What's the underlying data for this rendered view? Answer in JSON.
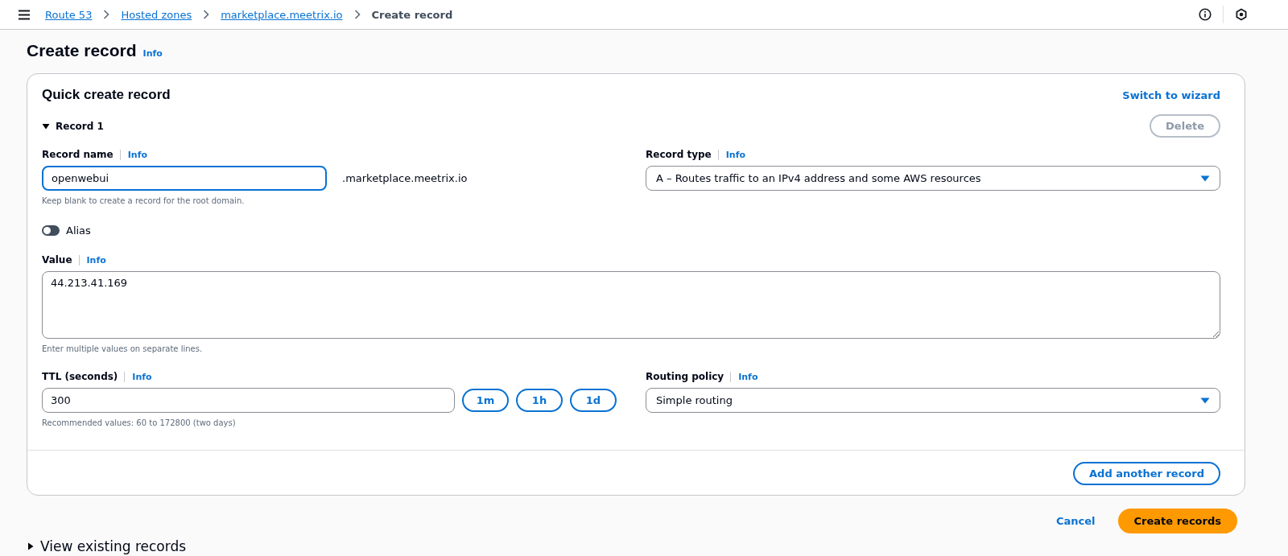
{
  "breadcrumbs": [
    {
      "label": "Route 53",
      "link": true
    },
    {
      "label": "Hosted zones",
      "link": true
    },
    {
      "label": "marketplace.meetrix.io",
      "link": true
    },
    {
      "label": "Create record",
      "link": false
    }
  ],
  "page": {
    "title": "Create record",
    "info": "Info"
  },
  "card": {
    "title": "Quick create record",
    "switch_link": "Switch to wizard",
    "record": {
      "title": "Record 1",
      "expanded": true,
      "delete_button": {
        "label": "Delete",
        "disabled": true
      },
      "record_name": {
        "label": "Record name",
        "info": "Info",
        "value": "openwebui",
        "suffix": ".marketplace.meetrix.io",
        "hint": "Keep blank to create a record for the root domain."
      },
      "record_type": {
        "label": "Record type",
        "info": "Info",
        "value": "A – Routes traffic to an IPv4 address and some AWS resources"
      },
      "alias": {
        "label": "Alias",
        "on": false
      },
      "value": {
        "label": "Value",
        "info": "Info",
        "value": "44.213.41.169",
        "hint": "Enter multiple values on separate lines."
      },
      "ttl": {
        "label": "TTL (seconds)",
        "info": "Info",
        "value": "300",
        "hint": "Recommended values: 60 to 172800 (two days)",
        "presets": [
          "1m",
          "1h",
          "1d"
        ]
      },
      "routing_policy": {
        "label": "Routing policy",
        "info": "Info",
        "value": "Simple routing"
      }
    },
    "add_button": "Add another record"
  },
  "actions": {
    "cancel": "Cancel",
    "submit": "Create records"
  },
  "existing": {
    "title": "View existing records",
    "expanded": false
  }
}
